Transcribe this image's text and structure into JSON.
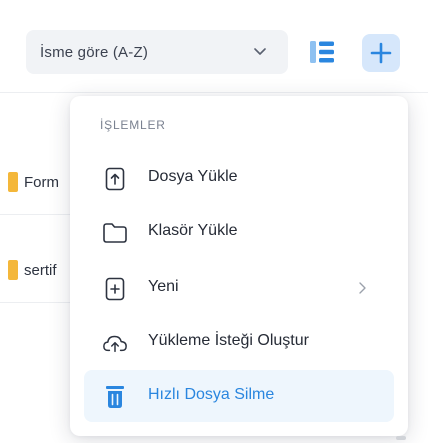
{
  "toolbar": {
    "sort_value": "İsme göre (A-Z)",
    "icons": {
      "sort_chevron": "chevron-down-icon",
      "list_view": "list-view-icon",
      "add": "plus-icon"
    },
    "colors": {
      "accent": "#2a86df",
      "add_bg": "#d6e7fb"
    }
  },
  "list": {
    "rows": [
      {
        "name": "Form",
        "icon": "folder-icon"
      },
      {
        "name": "sertif",
        "icon": "folder-icon"
      }
    ]
  },
  "menu": {
    "header": "İŞLEMLER",
    "items": [
      {
        "label": "Dosya Yükle",
        "icon": "file-upload-icon"
      },
      {
        "label": "Klasör Yükle",
        "icon": "folder-icon"
      },
      {
        "label": "Yeni",
        "icon": "file-plus-icon",
        "has_submenu": true
      },
      {
        "label": "Yükleme İsteği Oluştur",
        "icon": "cloud-upload-icon"
      },
      {
        "label": "Hızlı Dosya Silme",
        "icon": "trash-icon",
        "active": true
      }
    ]
  }
}
